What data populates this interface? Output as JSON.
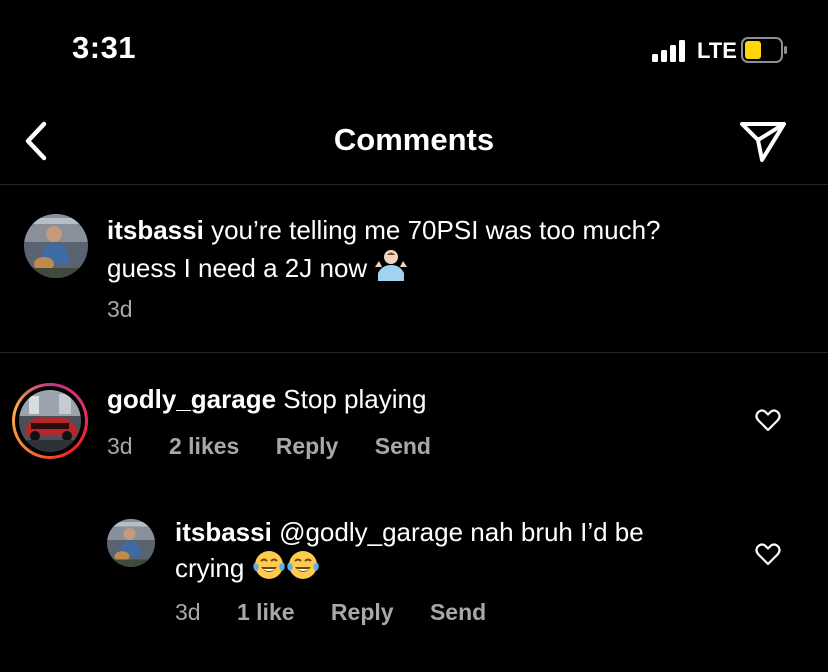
{
  "status_bar": {
    "time": "3:31",
    "network": "LTE"
  },
  "header": {
    "title": "Comments"
  },
  "caption": {
    "username": "itsbassi",
    "text_line1": "you’re telling me 70PSI was too much?",
    "text_line2": "guess I need a 2J now",
    "emoji": "shrug-emoji",
    "time": "3d"
  },
  "comments": [
    {
      "username": "godly_garage",
      "text": "Stop playing",
      "time": "3d",
      "likes": "2 likes",
      "reply_label": "Reply",
      "send_label": "Send"
    }
  ],
  "replies": [
    {
      "username": "itsbassi",
      "text_line1": "@godly_garage nah bruh I’d be",
      "text_line2": "crying",
      "emojis": [
        "tears-of-joy-emoji",
        "tears-of-joy-emoji"
      ],
      "time": "3d",
      "likes": "1 like",
      "reply_label": "Reply",
      "send_label": "Send"
    }
  ],
  "colors": {
    "background": "#000000",
    "meta_text": "#a8a8a8",
    "divider": "#262626",
    "battery": "#ffd60a"
  }
}
